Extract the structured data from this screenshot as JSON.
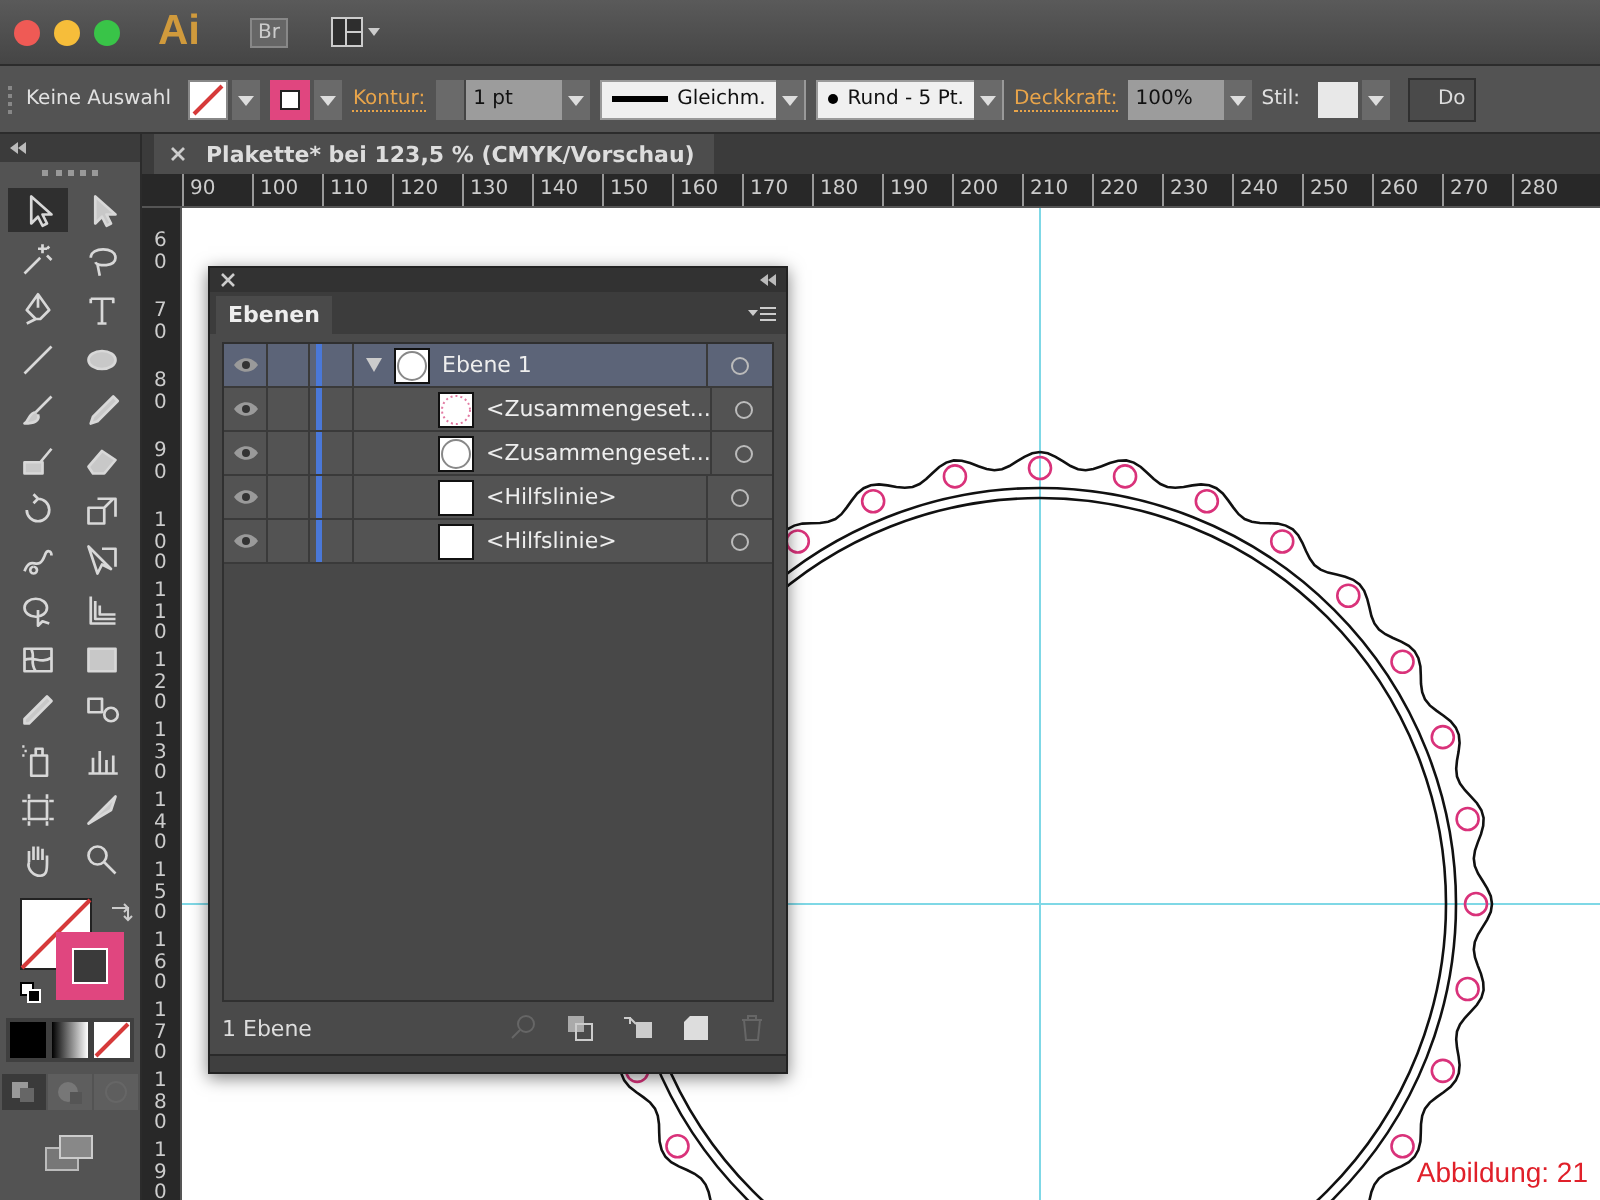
{
  "app": {
    "logo": "Ai",
    "bridge": "Br"
  },
  "control_bar": {
    "selection": "Keine Auswahl",
    "stroke_label": "Kontur:",
    "stroke_weight": "1 pt",
    "profile": "Gleichm.",
    "brush": "Rund - 5 Pt.",
    "opacity_label": "Deckkraft:",
    "opacity": "100%",
    "style_label": "Stil:",
    "doc_button": "Do"
  },
  "document_tab": {
    "title": "Plakette* bei 123,5 % (CMYK/Vorschau)"
  },
  "ruler": {
    "horizontal": [
      "90",
      "100",
      "110",
      "120",
      "130",
      "140",
      "150",
      "160",
      "170",
      "180",
      "190",
      "200",
      "210",
      "220",
      "230",
      "240",
      "250",
      "260",
      "270",
      "280"
    ],
    "vertical": [
      "60",
      "70",
      "80",
      "90",
      "100",
      "110",
      "120",
      "130",
      "140",
      "150",
      "160",
      "170",
      "180",
      "190"
    ]
  },
  "tools": [
    {
      "kind": "select",
      "selected": true
    },
    {
      "kind": "direct",
      "selected": false
    },
    {
      "kind": "wand",
      "selected": false
    },
    {
      "kind": "lasso",
      "selected": false
    },
    {
      "kind": "pen",
      "selected": false
    },
    {
      "kind": "type",
      "selected": false
    },
    {
      "kind": "line",
      "selected": false
    },
    {
      "kind": "ellipse",
      "selected": false
    },
    {
      "kind": "brush",
      "selected": false
    },
    {
      "kind": "pencil",
      "selected": false
    },
    {
      "kind": "blob",
      "selected": false
    },
    {
      "kind": "eraser",
      "selected": false
    },
    {
      "kind": "rotate",
      "selected": false
    },
    {
      "kind": "scale",
      "selected": false
    },
    {
      "kind": "warp",
      "selected": false
    },
    {
      "kind": "transform",
      "selected": false
    },
    {
      "kind": "builder",
      "selected": false
    },
    {
      "kind": "perspective",
      "selected": false
    },
    {
      "kind": "mesh",
      "selected": false
    },
    {
      "kind": "gradient",
      "selected": false
    },
    {
      "kind": "eyedropper",
      "selected": false
    },
    {
      "kind": "blend",
      "selected": false
    },
    {
      "kind": "sprayer",
      "selected": false
    },
    {
      "kind": "graph",
      "selected": false
    },
    {
      "kind": "artboard",
      "selected": false
    },
    {
      "kind": "slice",
      "selected": false
    },
    {
      "kind": "hand",
      "selected": false
    },
    {
      "kind": "zoom",
      "selected": false
    }
  ],
  "layers_panel": {
    "tab": "Ebenen",
    "layers": [
      {
        "name": "Ebene 1",
        "kind": "layer",
        "visible": true,
        "selected": true,
        "expanded": true,
        "color": "#4a78d8",
        "children": [
          {
            "name": "<Zusammengeset...",
            "kind": "dots",
            "visible": true,
            "selected": false
          },
          {
            "name": "<Zusammengeset...",
            "kind": "ring",
            "visible": true,
            "selected": false
          },
          {
            "name": "<Hilfslinie>",
            "kind": "guide",
            "visible": true,
            "selected": false
          },
          {
            "name": "<Hilfslinie>",
            "kind": "guide",
            "visible": true,
            "selected": false
          }
        ]
      }
    ],
    "footer": "1 Ebene"
  },
  "figure_label": "Abbildung: 21"
}
